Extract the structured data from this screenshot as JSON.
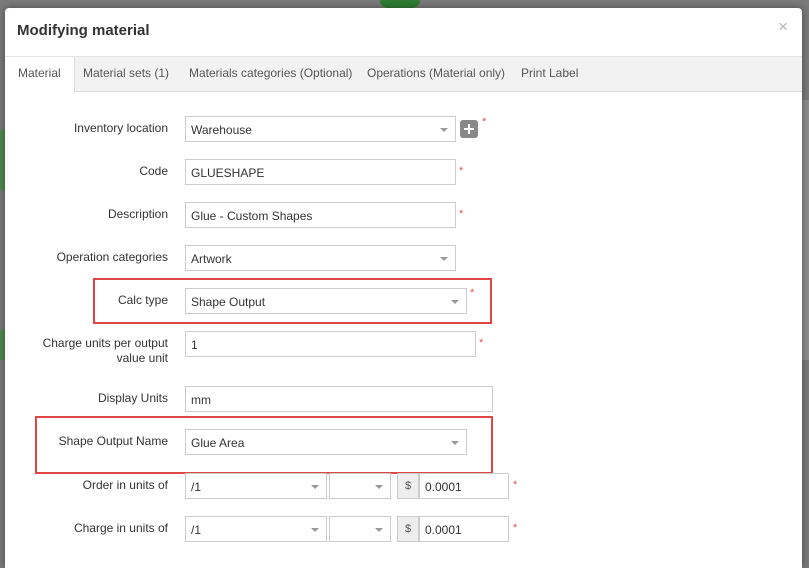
{
  "dialog": {
    "title": "Modifying material",
    "close_glyph": "×"
  },
  "tabs": [
    {
      "label": "Material"
    },
    {
      "label": "Material sets (1)"
    },
    {
      "label": "Materials categories (Optional)"
    },
    {
      "label": "Operations (Material only)"
    },
    {
      "label": "Print Label"
    }
  ],
  "form": {
    "inventory_location": {
      "label": "Inventory location",
      "value": "Warehouse"
    },
    "code": {
      "label": "Code",
      "value": "GLUESHAPE"
    },
    "description": {
      "label": "Description",
      "value": "Glue - Custom Shapes"
    },
    "operation_categories": {
      "label": "Operation categories",
      "value": "Artwork"
    },
    "calc_type": {
      "label": "Calc type",
      "value": "Shape Output"
    },
    "charge_units": {
      "label_line1": "Charge units per output",
      "label_line2": "value unit",
      "value": "1"
    },
    "display_units": {
      "label": "Display Units",
      "value": "mm"
    },
    "shape_output_name": {
      "label": "Shape Output Name",
      "value": "Glue Area"
    },
    "order_units": {
      "label": "Order in units of",
      "unit": "/1",
      "second": "",
      "currency": "$",
      "price": "0.0001"
    },
    "charge_in_units": {
      "label": "Charge in units of",
      "unit": "/1",
      "second": "",
      "currency": "$",
      "price": "0.0001"
    },
    "required_mark": "*"
  },
  "colors": {
    "accent_highlight": "#e04646",
    "required": "#d9534f"
  }
}
